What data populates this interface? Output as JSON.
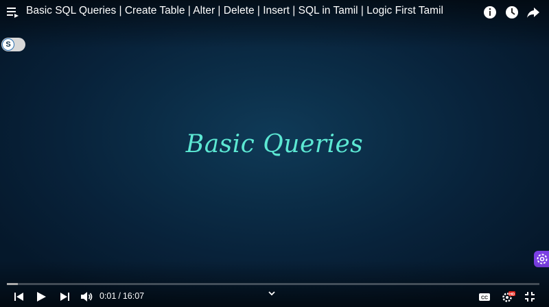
{
  "video": {
    "title": "Basic SQL Queries | Create Table | Alter | Delete | Insert | SQL in Tamil | Logic First Tamil",
    "slide_text": "Basic Queries",
    "current_time": "0:01",
    "duration": "16:07",
    "separator": "/",
    "progress_fraction": 0.021
  },
  "extension_toggle": {
    "label": "S"
  },
  "icons": {
    "playlist": "playlist-icon",
    "info": "info-icon",
    "watch_later": "clock-icon",
    "share": "share-icon",
    "prev": "previous-icon",
    "play": "play-icon",
    "next": "next-icon",
    "volume": "volume-icon",
    "chevron": "chevron-down-icon",
    "captions": "cc-icon",
    "settings": "settings-hd-icon",
    "exit_fullscreen": "exit-fullscreen-icon",
    "extension_gear": "gear-icon"
  },
  "colors": {
    "slide_text": "#5ce8d3",
    "background": "#0b2d47",
    "hd_badge": "#e62117",
    "extension_button": "#7b3fe4"
  }
}
